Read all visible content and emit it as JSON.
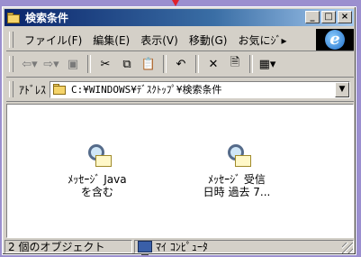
{
  "window": {
    "title": "検索条件"
  },
  "titlebar_buttons": [
    "_",
    "□",
    "×"
  ],
  "menu": {
    "items": [
      "ファイル(F)",
      "編集(E)",
      "表示(V)",
      "移動(G)",
      "お気にｼﾞ▸"
    ]
  },
  "toolbar": {
    "back": "⇦▾",
    "forward": "⇨▾",
    "up": "▣",
    "cut": "✂",
    "copy": "⧉",
    "paste": "📋",
    "undo": "↶",
    "delete": "✕",
    "properties": "🗎",
    "views": "▦▾"
  },
  "address": {
    "label": "ｱﾄﾞﾚｽ",
    "path": "C:¥WINDOWS¥ﾃﾞｽｸﾄｯﾌﾟ¥検索条件",
    "dropdown": "▼"
  },
  "files": [
    {
      "line1": "ﾒｯｾｰｼﾞ Java",
      "line2": "を含む",
      "icon": "search-icon"
    },
    {
      "line1": "ﾒｯｾｰｼﾞ 受信",
      "line2": "日時 過去 7...",
      "icon": "search-icon"
    }
  ],
  "status": {
    "count": "2 個のオブジェクト",
    "location": "ﾏｲ ｺﾝﾋﾟｭｰﾀ"
  },
  "colors": {
    "titlebar_start": "#0a246a",
    "titlebar_end": "#a6caf0",
    "desktop": "#9b8fcf"
  }
}
